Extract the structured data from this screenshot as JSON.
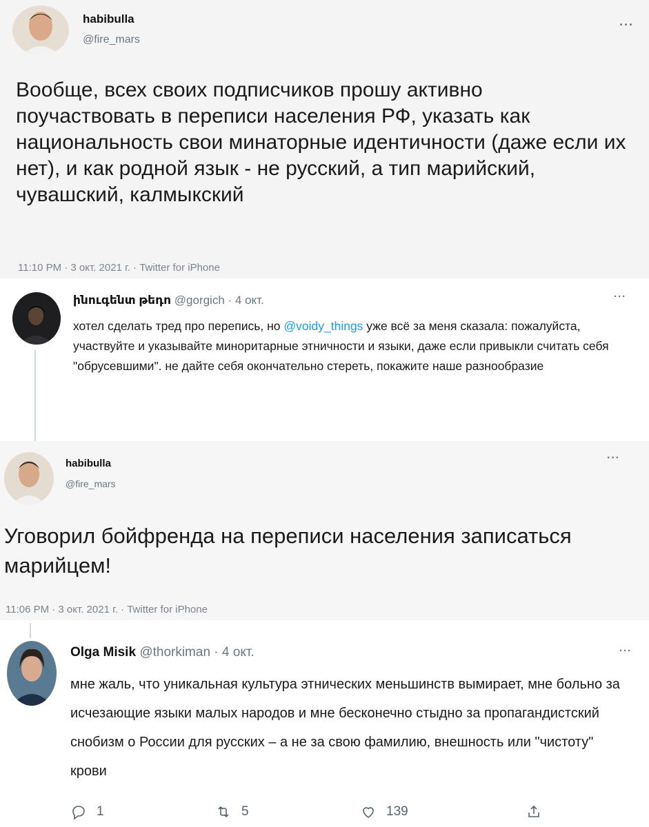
{
  "tweet1": {
    "name": "habibulla",
    "handle": "@fire_mars",
    "more": "···",
    "text": "Вообще, всех своих подписчиков прошу активно поучаствовать в переписи населения РФ, указать как национальность свои минаторные идентичности (даже если их нет), и как родной язык - не русский, а тип марийский, чувашский, калмыкский",
    "meta": "11:10 PM · 3 окт. 2021 г. · Twitter for iPhone"
  },
  "tweet2": {
    "name": "ինուգենտ թեդո",
    "handle": "@gorgich · 4 окт.",
    "more": "···",
    "text_before": "хотел сделать тред про перепись, но ",
    "mention": "@voidy_things",
    "text_after": " уже всё за меня сказала: пожалуйста, участвуйте и указывайте миноритарные этничности и языки, даже если привыкли считать себя \"обрусевшими\". не дайте себя окончательно стереть, покажите наше разнообразие"
  },
  "tweet3": {
    "name": "habibulla",
    "handle": "@fire_mars",
    "more": "···",
    "text": "Уговорил бойфренда на переписи населения записаться марийцем!",
    "meta": "11:06 PM · 3 окт. 2021 г. · Twitter for iPhone"
  },
  "tweet4": {
    "name": "Olga Misik",
    "handle": "@thorkiman · 4 окт.",
    "more": "···",
    "text": "мне жаль, что уникальная культура этнических меньшинств вымирает, мне больно за исчезающие языки малых народов и мне бесконечно стыдно за пропагандистский снобизм о России для русских – а не за свою фамилию, внешность или \"чистоту\" крови",
    "actions": {
      "reply_icon": "reply-icon",
      "reply_count": "1",
      "retweet_icon": "retweet-icon",
      "retweet_count": "5",
      "like_icon": "heart-icon",
      "like_count": "139",
      "share_icon": "share-icon"
    }
  },
  "colors": {
    "mention": "#1d9bf0",
    "secondary_text": "#6b7780",
    "thread_line": "#cfd9de"
  }
}
